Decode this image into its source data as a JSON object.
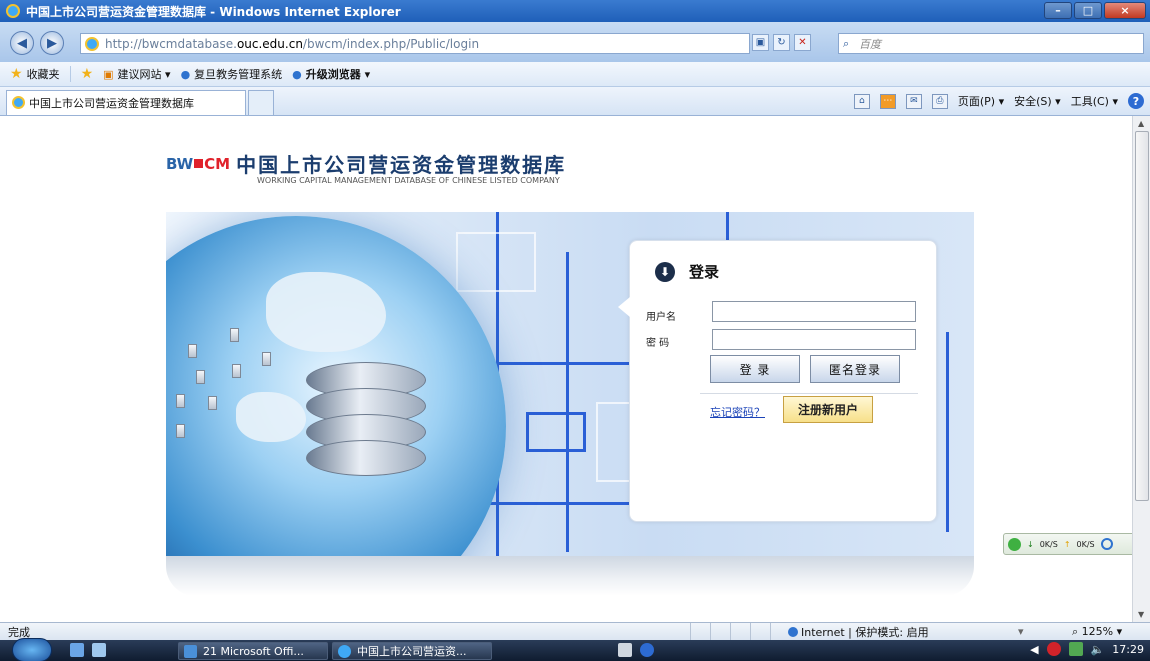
{
  "window": {
    "title": "中国上市公司营运资金管理数据库 - Windows Internet Explorer",
    "controls": [
      "–",
      "□",
      "×"
    ]
  },
  "address_bar": {
    "url_prefix": "http://bwcmdatabase.",
    "url_domain": "ouc.edu.cn",
    "url_suffix": "/bwcm/index.php/Public/login"
  },
  "search": {
    "placeholder": "百度"
  },
  "favorites_bar": {
    "items": [
      "收藏夹",
      "建议网站 ▾",
      "复旦教务管理系统",
      "升级浏览器 ▾"
    ]
  },
  "tabs": [
    {
      "label": "中国上市公司营运资金管理数据库"
    }
  ],
  "command_bar": {
    "page": "页面(P) ▾",
    "safety": "安全(S) ▾",
    "tools": "工具(C) ▾",
    "help": "?"
  },
  "page": {
    "logo": {
      "mark_left": "BW",
      "mark_right": "CM",
      "title_cn": "中国上市公司营运资金管理数据库",
      "title_en": "WORKING CAPITAL MANAGEMENT DATABASE OF CHINESE LISTED COMPANY"
    },
    "login": {
      "title": "登录",
      "username_label": "用户名",
      "password_label": "密  码",
      "username_value": "",
      "password_value": "",
      "login_button": "登 录",
      "anonymous_button": "匿名登录",
      "forgot_link": "忘记密码？",
      "register_button": "注册新用户"
    },
    "speed_widget": {
      "down": "0K/S",
      "up": "0K/S"
    }
  },
  "status_bar": {
    "status": "完成",
    "zone": "Internet | 保护模式: 启用",
    "zoom": "125%"
  },
  "taskbar": {
    "tasks": [
      "21 Microsoft Offi...",
      "中国上市公司营运资..."
    ],
    "clock": "17:29"
  }
}
